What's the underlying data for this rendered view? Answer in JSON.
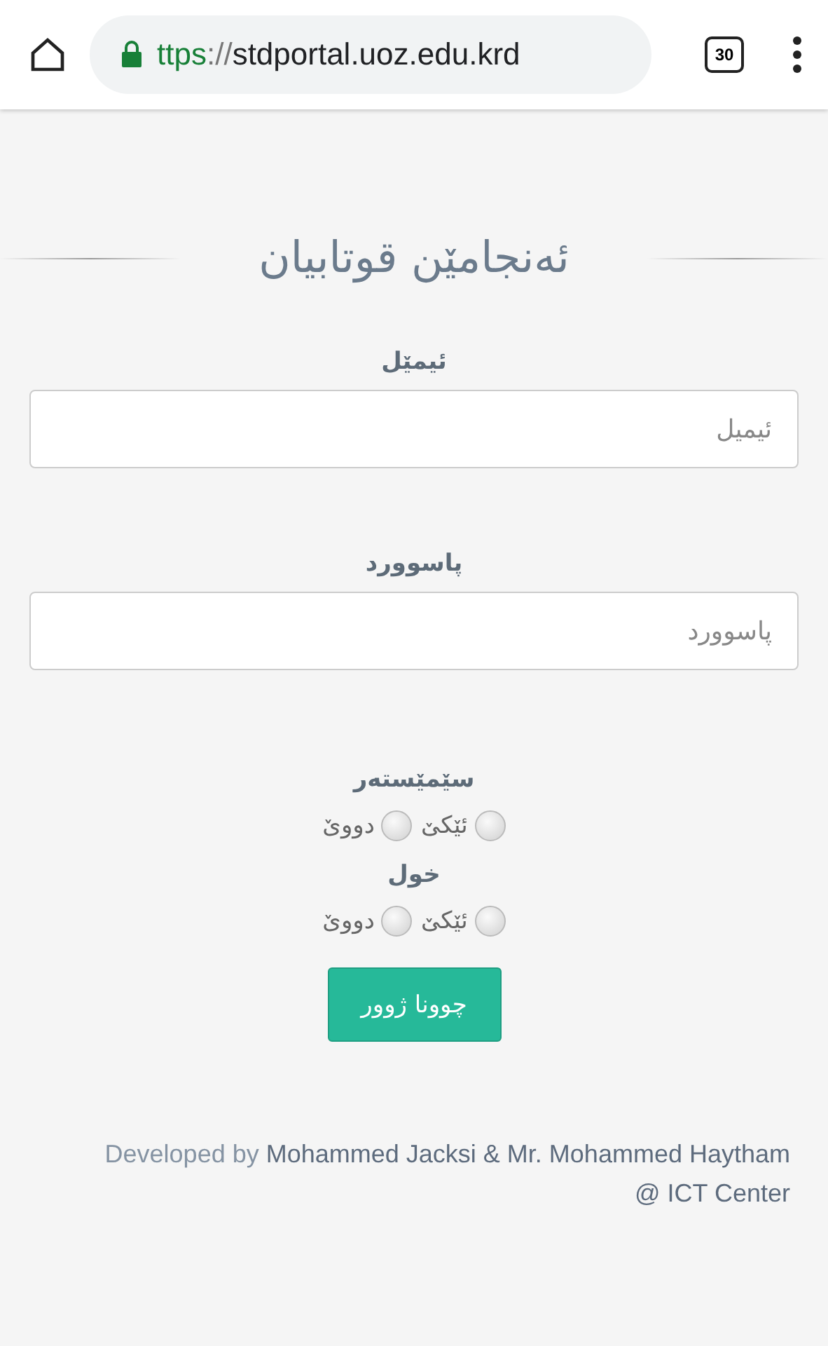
{
  "browser": {
    "url_scheme": "ttps",
    "url_separator": "://",
    "url_host": "stdportal.uoz.edu.krd",
    "tab_count": "30"
  },
  "title": "ئەنجامێن قوتابیان",
  "fields": [
    {
      "label": "ئیمێل",
      "placeholder": "ئیمیل"
    },
    {
      "label": "پاسوورد",
      "placeholder": "پاسوورد"
    }
  ],
  "radio_groups": [
    {
      "label": "سێمێستەر",
      "options": [
        {
          "label": "ئێکێ",
          "selected": false
        },
        {
          "label": "دووێ",
          "selected": false
        }
      ]
    },
    {
      "label": "خول",
      "options": [
        {
          "label": "ئێکێ",
          "selected": false
        },
        {
          "label": "دووێ",
          "selected": false
        }
      ]
    }
  ],
  "submit": "چوونا ژوور",
  "footer": {
    "prefix": "Developed by",
    "credit": "Mohammed Jacksi & Mr. Mohammed Haytham @ ICT Center"
  }
}
